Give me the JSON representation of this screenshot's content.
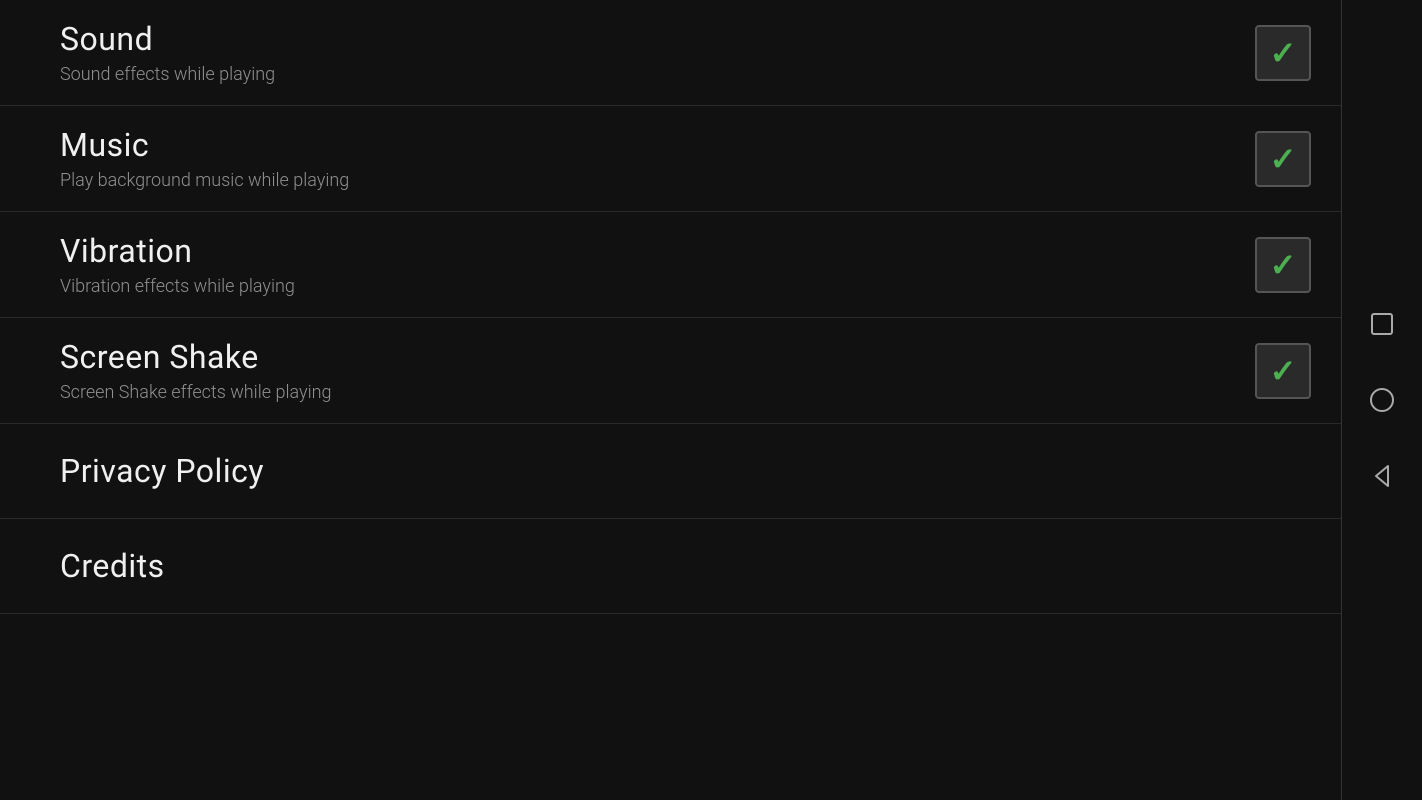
{
  "settings": {
    "items": [
      {
        "id": "sound",
        "title": "Sound",
        "subtitle": "Sound effects while playing",
        "checked": true,
        "hasCheckbox": true
      },
      {
        "id": "music",
        "title": "Music",
        "subtitle": "Play background music while playing",
        "checked": true,
        "hasCheckbox": true
      },
      {
        "id": "vibration",
        "title": "Vibration",
        "subtitle": "Vibration effects while playing",
        "checked": true,
        "hasCheckbox": true
      },
      {
        "id": "screen-shake",
        "title": "Screen Shake",
        "subtitle": "Screen Shake effects while playing",
        "checked": true,
        "hasCheckbox": true
      }
    ],
    "links": [
      {
        "id": "privacy-policy",
        "title": "Privacy Policy"
      },
      {
        "id": "credits",
        "title": "Credits"
      }
    ]
  },
  "navbar": {
    "square_label": "recent-apps",
    "circle_label": "home",
    "triangle_label": "back"
  }
}
